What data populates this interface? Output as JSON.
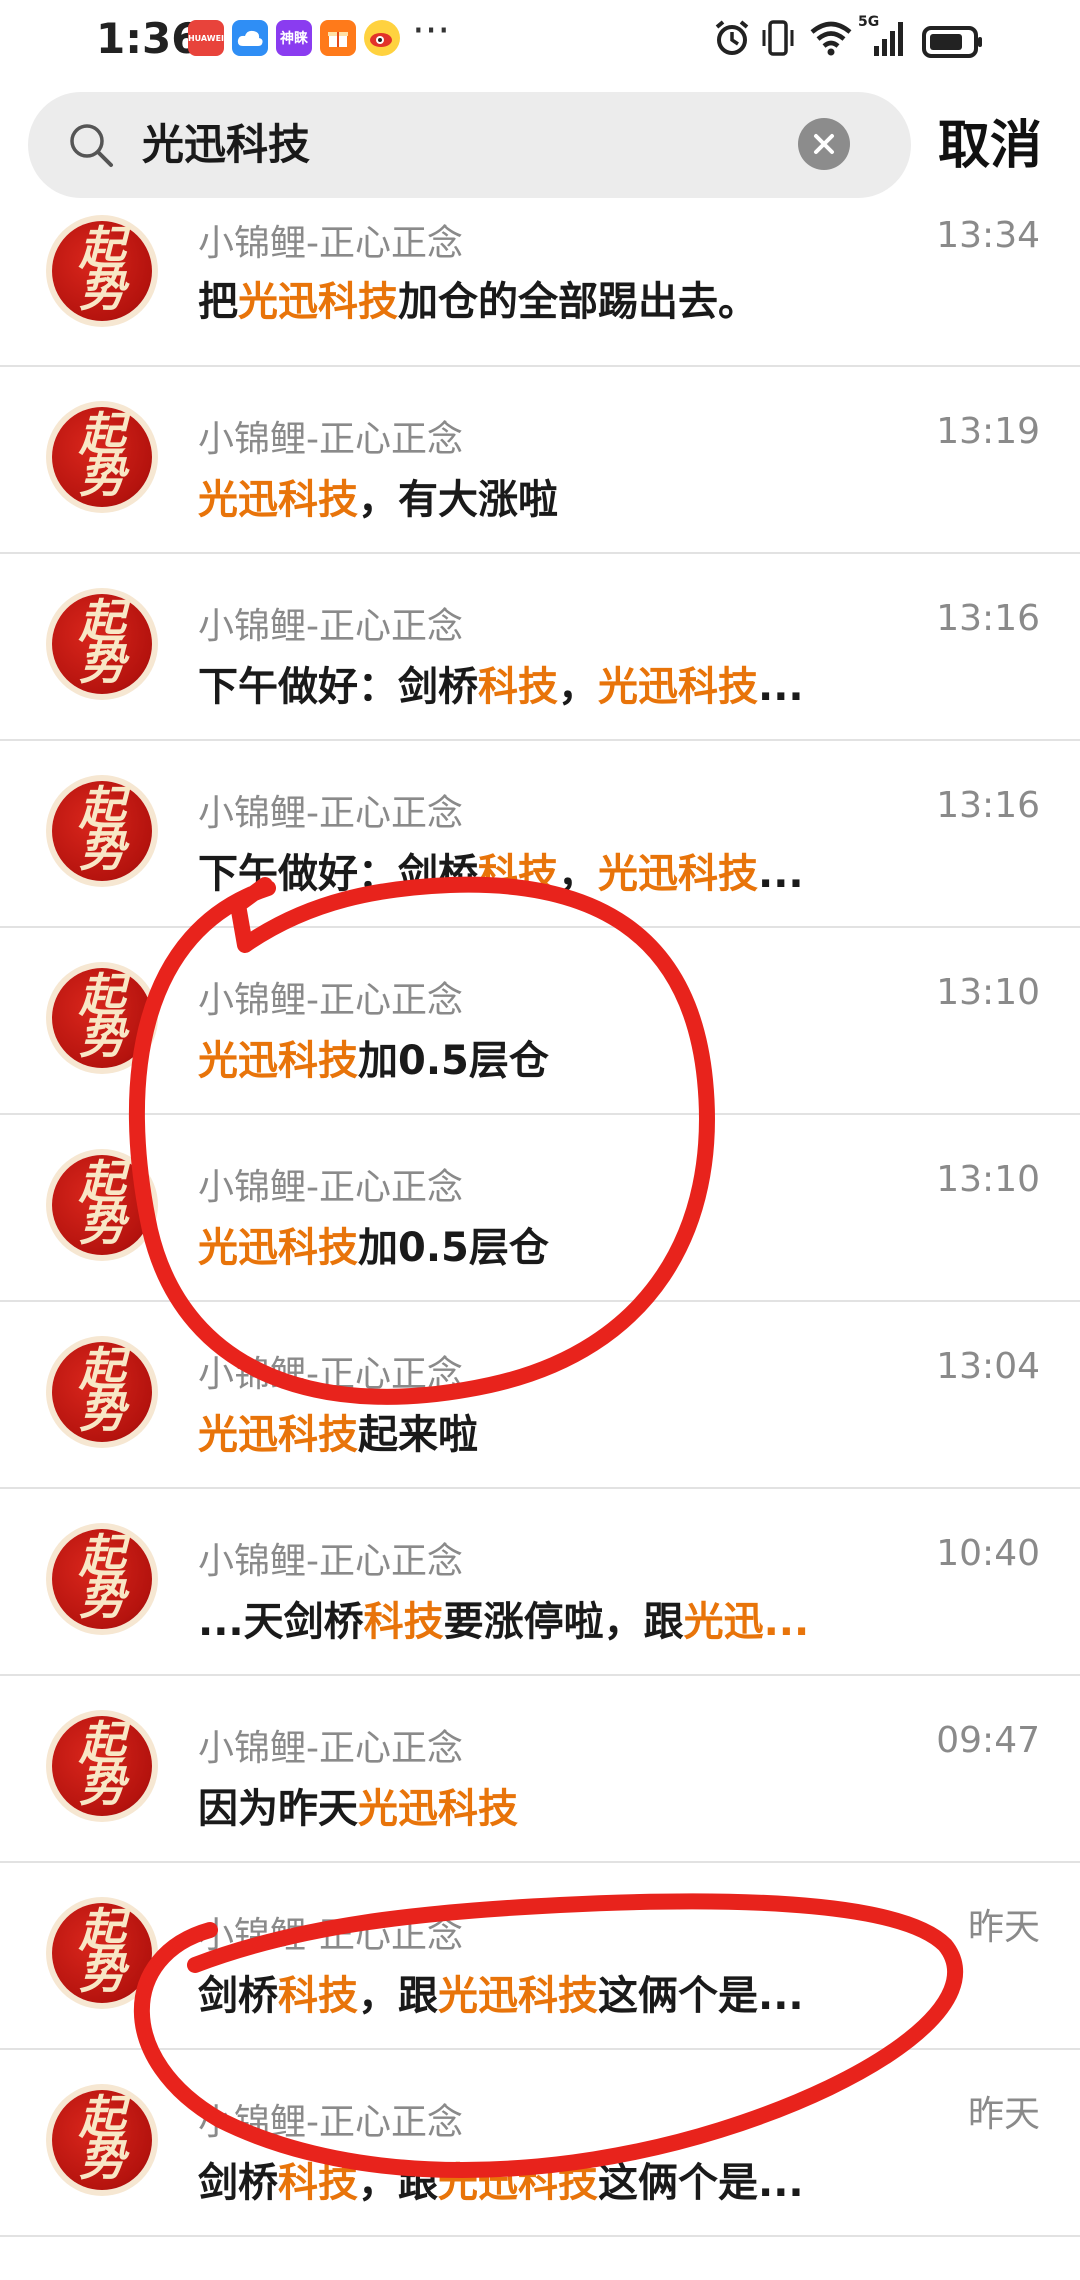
{
  "status_bar": {
    "time": "1:36",
    "app_icons": [
      {
        "name": "huawei-icon",
        "label": "HUAWEI",
        "color": "#e8433b"
      },
      {
        "name": "cloud-icon",
        "label": "",
        "color": "#2f8ef5"
      },
      {
        "name": "shenma-icon",
        "label": "神睐",
        "color": "#8a3cf0"
      },
      {
        "name": "gift-icon",
        "label": "",
        "color": "#e64a19"
      },
      {
        "name": "weibo-icon",
        "label": "",
        "color": "#e2322a"
      }
    ],
    "more": "···",
    "network": "5G"
  },
  "search": {
    "query": "光迅科技",
    "cancel_label": "取消"
  },
  "colors": {
    "highlight": "#e8740a",
    "annotation": "#e8231c"
  },
  "results": [
    {
      "sender": "小锦鲤-正心正念",
      "time": "13:34",
      "parts": [
        {
          "t": "把",
          "h": false
        },
        {
          "t": "光迅科技",
          "h": true
        },
        {
          "t": "加仓的全部踢出去。",
          "h": false
        }
      ]
    },
    {
      "sender": "小锦鲤-正心正念",
      "time": "13:19",
      "parts": [
        {
          "t": "光迅科技",
          "h": true
        },
        {
          "t": "，有大涨啦",
          "h": false
        }
      ]
    },
    {
      "sender": "小锦鲤-正心正念",
      "time": "13:16",
      "parts": [
        {
          "t": "下午做好：剑桥",
          "h": false
        },
        {
          "t": "科技",
          "h": true
        },
        {
          "t": "，",
          "h": false
        },
        {
          "t": "光迅科技",
          "h": true
        },
        {
          "t": "...",
          "h": false
        }
      ]
    },
    {
      "sender": "小锦鲤-正心正念",
      "time": "13:16",
      "parts": [
        {
          "t": "下午做好：剑桥",
          "h": false
        },
        {
          "t": "科技",
          "h": true
        },
        {
          "t": "，",
          "h": false
        },
        {
          "t": "光迅科技",
          "h": true
        },
        {
          "t": "...",
          "h": false
        }
      ]
    },
    {
      "sender": "小锦鲤-正心正念",
      "time": "13:10",
      "parts": [
        {
          "t": "光迅科技",
          "h": true
        },
        {
          "t": "加0.5层仓",
          "h": false
        }
      ]
    },
    {
      "sender": "小锦鲤-正心正念",
      "time": "13:10",
      "parts": [
        {
          "t": "光迅科技",
          "h": true
        },
        {
          "t": "加0.5层仓",
          "h": false
        }
      ]
    },
    {
      "sender": "小锦鲤-正心正念",
      "time": "13:04",
      "parts": [
        {
          "t": "光迅科技",
          "h": true
        },
        {
          "t": "起来啦",
          "h": false
        }
      ]
    },
    {
      "sender": "小锦鲤-正心正念",
      "time": "10:40",
      "parts": [
        {
          "t": "...天剑桥",
          "h": false
        },
        {
          "t": "科技",
          "h": true
        },
        {
          "t": "要涨停啦，跟",
          "h": false
        },
        {
          "t": "光迅...",
          "h": true
        }
      ]
    },
    {
      "sender": "小锦鲤-正心正念",
      "time": "09:47",
      "parts": [
        {
          "t": "因为昨天",
          "h": false
        },
        {
          "t": "光迅科技",
          "h": true
        }
      ]
    },
    {
      "sender": "小锦鲤-正心正念",
      "time": "昨天",
      "parts": [
        {
          "t": "剑桥",
          "h": false
        },
        {
          "t": "科技",
          "h": true
        },
        {
          "t": "，跟",
          "h": false
        },
        {
          "t": "光迅科技",
          "h": true
        },
        {
          "t": "这俩个是...",
          "h": false
        }
      ]
    },
    {
      "sender": "小锦鲤-正心正念",
      "time": "昨天",
      "parts": [
        {
          "t": "剑桥",
          "h": false
        },
        {
          "t": "科技",
          "h": true
        },
        {
          "t": "，跟",
          "h": false
        },
        {
          "t": "光迅科技",
          "h": true
        },
        {
          "t": "这俩个是...",
          "h": false
        }
      ]
    }
  ],
  "avatar_text": [
    "起",
    "势"
  ]
}
